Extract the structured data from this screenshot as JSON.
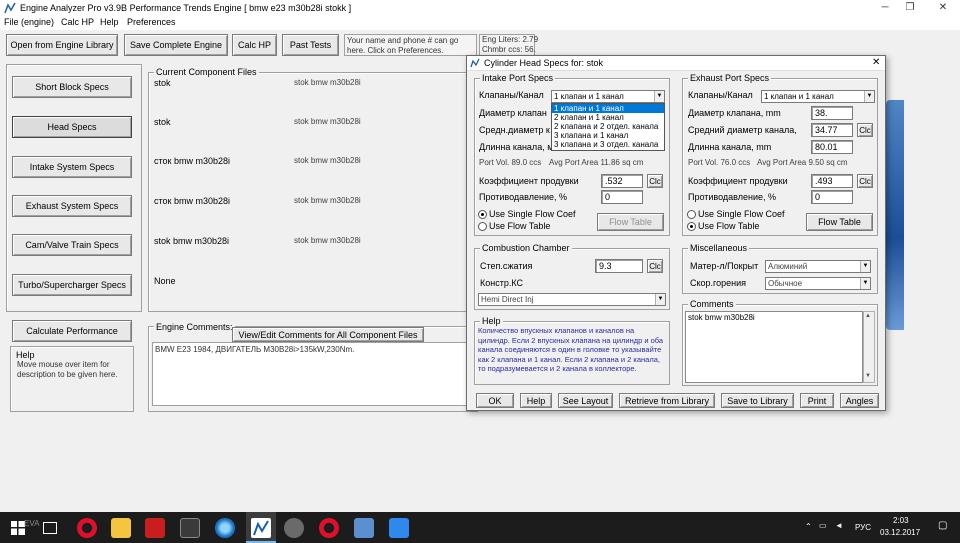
{
  "window": {
    "title": "Engine Analyzer Pro v3.9B   Performance Trends    Engine [ bmw e23 m30b28i stokk ]",
    "controls": {
      "minimize": "─",
      "restore": "❐",
      "close": "✕"
    }
  },
  "menu": [
    "File (engine)",
    "Calc HP",
    "Help",
    "Preferences"
  ],
  "toolbar": {
    "open_library": "Open from Engine Library",
    "save_complete": "Save Complete Engine",
    "calc_hp": "Calc HP",
    "past_tests": "Past Tests",
    "name_phone_note": "Your name and phone # can go here.  Click on Preferences.",
    "eng_liters": "Eng Liters:  2.79",
    "chmbr_ccs": "Chmbr ccs:  56."
  },
  "left_buttons": [
    "Short Block Specs",
    "Head Specs",
    "Intake System Specs",
    "Exhaust System Specs",
    "Cam/Valve Train Specs",
    "Turbo/Supercharger Specs"
  ],
  "calculate_button": "Calculate Performance",
  "help_box": {
    "title": "Help",
    "text": "Move mouse over item for description to be given here."
  },
  "components": {
    "title": "Current Component Files",
    "rows": [
      {
        "name": "stok",
        "file": "stok bmw m30b28i"
      },
      {
        "name": "stok",
        "file": "stok bmw m30b28i"
      },
      {
        "name": "сток bmw m30b28i",
        "file": "stok bmw m30b28i"
      },
      {
        "name": "сток bmw m30b28i",
        "file": "stok bmw m30b28i"
      },
      {
        "name": "stok bmw m30b28i",
        "file": "stok bmw m30b28i"
      },
      {
        "name": "None",
        "file": ""
      }
    ]
  },
  "engine_comments": {
    "label": "Engine Comments:",
    "button": "View/Edit Comments for All Component Files",
    "text": "BMW E23 1984, ДВИГАТЕЛЬ M30B28i>135kW,230Nm."
  },
  "dialog": {
    "title": "Cylinder Head Specs for: stok",
    "close": "✕",
    "intake": {
      "title": "Intake Port Specs",
      "valves_label": "Клапаны/Канал",
      "valves_value": "1 клапан и 1 канал",
      "dropdown_options": [
        "1 клапан и 1 канал",
        "2 клапан и 1 канал",
        "2 клапана и 2 отдел. канала",
        "3 клапана и 1 канал",
        "3 клапана и 3 отдел. канала"
      ],
      "diam_label": "Диаметр клапан",
      "avg_label": "Средн.диаметр к",
      "len_label": "Длинна канала, м",
      "port_vol": "Port Vol. 89.0 ccs",
      "avg_area": "Avg Port Area 11.86 sq cm",
      "flow_coef_label": "Коэффициент продувки",
      "flow_coef_value": ".532",
      "backflow_label": "Противодавление, %",
      "backflow_value": "0",
      "use_single": "Use Single Flow Coef",
      "use_table": "Use Flow Table",
      "flow_table_btn": "Flow Table",
      "clc": "Clc"
    },
    "exhaust": {
      "title": "Exhaust Port Specs",
      "valves_label": "Клапаны/Канал",
      "valves_value": "1 клапан и 1 канал",
      "diam_label": "Диаметр клапана, mm",
      "diam_value": "38.",
      "avg_label": "Средний диаметр канала,",
      "avg_value": "34.77",
      "len_label": "Длинна канала, mm",
      "len_value": "80.01",
      "port_vol": "Port Vol. 76.0 ccs",
      "avg_area": "Avg Port Area 9.50 sq cm",
      "flow_coef_label": "Коэффициент продувки",
      "flow_coef_value": ".493",
      "backflow_label": "Противодавление, %",
      "backflow_value": "0",
      "use_single": "Use Single Flow Coef",
      "use_table": "Use Flow Table",
      "flow_table_btn": "Flow Table",
      "clc": "Clc"
    },
    "combustion": {
      "title": "Combustion Chamber",
      "cr_label": "Степ.сжатия",
      "cr_value": "9.3",
      "konstr_label": "Констр.КС",
      "konstr_value": "Hemi Direct Inj",
      "clc": "Clc"
    },
    "misc": {
      "title": "Miscellaneous",
      "material_label": "Матер-л/Покрыт",
      "material_value": "Алюминий",
      "speed_label": "Скор.горения",
      "speed_value": "Обычное"
    },
    "help": {
      "title": "Help",
      "text": "Количество впускных клапанов и каналов на цилиндр. Если 2 впускных клапана на цилиндр и оба канала соединяются в один в головке то указывайте как 2 клапана и 1 канал. Если 2 клапана и 2 канала, то подразумевается и 2 канала в коллекторе."
    },
    "comments": {
      "title": "Comments",
      "text": "stok bmw m30b28i"
    },
    "buttons": [
      "OK",
      "Help",
      "See Layout",
      "Retrieve from Library",
      "Save to Library",
      "Print",
      "Angles"
    ]
  },
  "taskbar": {
    "start_icon": "windows-start-icon",
    "overlay_text": "EVA",
    "tray": {
      "lang": "РУС",
      "time": "2:03",
      "date": "03.12.2017"
    }
  }
}
